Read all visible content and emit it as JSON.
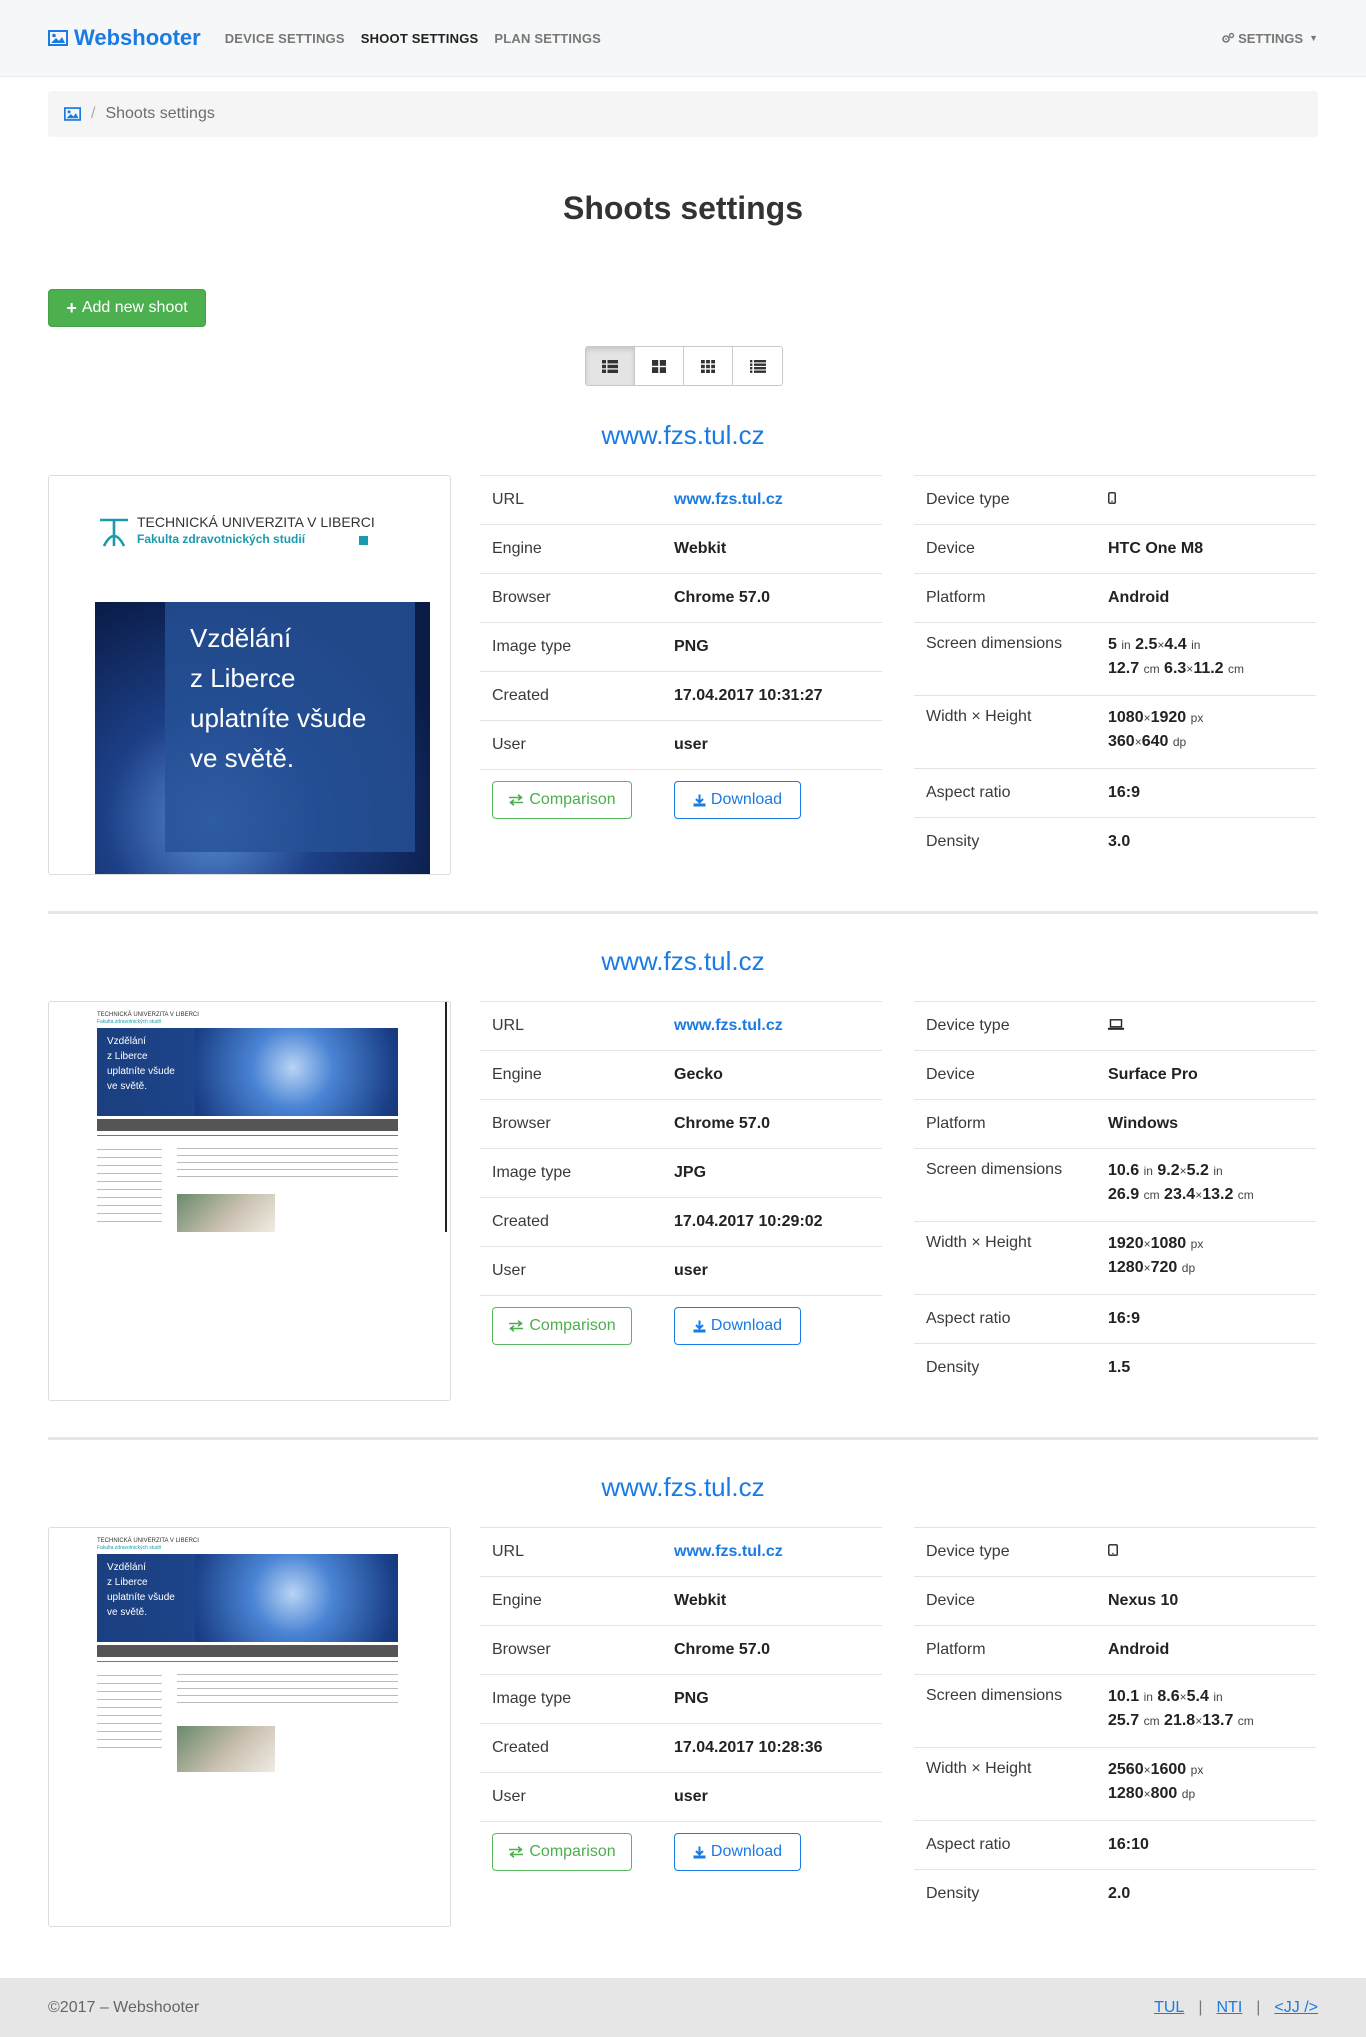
{
  "navbar": {
    "brand": "Webshooter",
    "links": [
      {
        "label": "DEVICE SETTINGS",
        "active": false
      },
      {
        "label": "SHOOT SETTINGS",
        "active": true
      },
      {
        "label": "PLAN SETTINGS",
        "active": false
      }
    ],
    "settings_label": "SETTINGS"
  },
  "breadcrumb": {
    "current": "Shoots settings",
    "separator": "/"
  },
  "page_title": "Shoots settings",
  "add_button_label": "Add new shoot",
  "view_modes": [
    "th-list-icon",
    "th-large-icon",
    "th-icon",
    "list-icon"
  ],
  "labels": {
    "url": "URL",
    "engine": "Engine",
    "browser": "Browser",
    "image_type": "Image type",
    "created": "Created",
    "user": "User",
    "comparison": "Comparison",
    "download": "Download",
    "device_type": "Device type",
    "device": "Device",
    "platform": "Platform",
    "screen_dimensions": "Screen dimensions",
    "width_height": "Width × Height",
    "aspect_ratio": "Aspect ratio",
    "density": "Density",
    "unit_in": "in",
    "unit_cm": "cm",
    "unit_px": "px",
    "unit_dp": "dp",
    "times": "×"
  },
  "shoots": [
    {
      "title": "www.fzs.tul.cz",
      "url": "www.fzs.tul.cz",
      "engine": "Webkit",
      "browser": "Chrome 57.0",
      "image_type": "PNG",
      "created": "17.04.2017 10:31:27",
      "user": "user",
      "device_type_icon": "mobile-phone-icon",
      "device": "HTC One M8",
      "platform": "Android",
      "diag_in": "5",
      "w_in": "2.5",
      "h_in": "4.4",
      "diag_cm": "12.7",
      "w_cm": "6.3",
      "h_cm": "11.2",
      "px_w": "1080",
      "px_h": "1920",
      "dp_w": "360",
      "dp_h": "640",
      "aspect": "16:9",
      "density": "3.0",
      "thumb": {
        "uni": "TECHNICKÁ UNIVERZITA V LIBERCI",
        "faculty": "Fakulta zdravotnických studií",
        "hero": [
          "Vzdělání",
          "z Liberce",
          "uplatníte všude",
          "ve světě."
        ]
      }
    },
    {
      "title": "www.fzs.tul.cz",
      "url": "www.fzs.tul.cz",
      "engine": "Gecko",
      "browser": "Chrome 57.0",
      "image_type": "JPG",
      "created": "17.04.2017 10:29:02",
      "user": "user",
      "device_type_icon": "laptop-icon",
      "device": "Surface Pro",
      "platform": "Windows",
      "diag_in": "10.6",
      "w_in": "9.2",
      "h_in": "5.2",
      "diag_cm": "26.9",
      "w_cm": "23.4",
      "h_cm": "13.2",
      "px_w": "1920",
      "px_h": "1080",
      "dp_w": "1280",
      "dp_h": "720",
      "aspect": "16:9",
      "density": "1.5",
      "thumb": {
        "uni": "TECHNICKÁ UNIVERZITA V LIBERCI",
        "faculty": "Fakulta zdravotnických studií",
        "hero": [
          "Vzdělání",
          "z Liberce",
          "uplatníte všude",
          "ve světě."
        ]
      }
    },
    {
      "title": "www.fzs.tul.cz",
      "url": "www.fzs.tul.cz",
      "engine": "Webkit",
      "browser": "Chrome 57.0",
      "image_type": "PNG",
      "created": "17.04.2017 10:28:36",
      "user": "user",
      "device_type_icon": "tablet-icon",
      "device": "Nexus 10",
      "platform": "Android",
      "diag_in": "10.1",
      "w_in": "8.6",
      "h_in": "5.4",
      "diag_cm": "25.7",
      "w_cm": "21.8",
      "h_cm": "13.7",
      "px_w": "2560",
      "px_h": "1600",
      "dp_w": "1280",
      "dp_h": "800",
      "aspect": "16:10",
      "density": "2.0",
      "thumb": {
        "uni": "TECHNICKÁ UNIVERZITA V LIBERCI",
        "faculty": "Fakulta zdravotnických studií",
        "hero": [
          "Vzdělání",
          "z Liberce",
          "uplatníte všude",
          "ve světě."
        ]
      }
    }
  ],
  "footer": {
    "copyright": "©2017 – Webshooter",
    "links": [
      "TUL",
      "NTI",
      "<JJ />"
    ],
    "separator": "|"
  },
  "colors": {
    "brand": "#1a7be4",
    "success": "#4cb04f",
    "footer_bg": "#e6e6e6"
  }
}
